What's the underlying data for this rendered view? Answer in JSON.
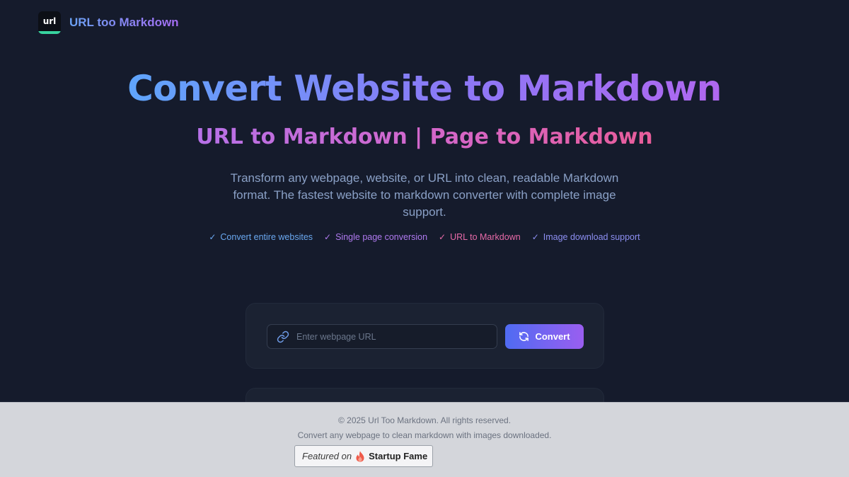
{
  "header": {
    "logo_text": "url",
    "brand": "URL too Markdown"
  },
  "hero": {
    "title": "Convert Website to Markdown",
    "subtitle": "URL to Markdown | Page to Markdown",
    "description": "Transform any webpage, website, or URL into clean, readable Markdown format. The fastest website to markdown converter with complete image support.",
    "features": [
      "Convert entire websites",
      "Single page conversion",
      "URL to Markdown",
      "Image download support"
    ]
  },
  "converter": {
    "url_placeholder": "Enter webpage URL",
    "url_value": "",
    "convert_label": "Convert"
  },
  "footer": {
    "copyright": "© 2025 Url Too Markdown. All rights reserved.",
    "tagline": "Convert any webpage to clean markdown with images downloaded.",
    "badge_featured": "Featured on",
    "badge_brand": "Startup Fame"
  },
  "icons": {
    "link": "link-icon",
    "refresh": "refresh-icon",
    "check": "check-icon",
    "flame": "flame-icon"
  },
  "colors": {
    "background": "#151b2c",
    "accent_blue": "#5fa5fb",
    "accent_purple": "#b067f0",
    "accent_pink": "#e85d9a",
    "footer_bg": "#d4d6db"
  }
}
